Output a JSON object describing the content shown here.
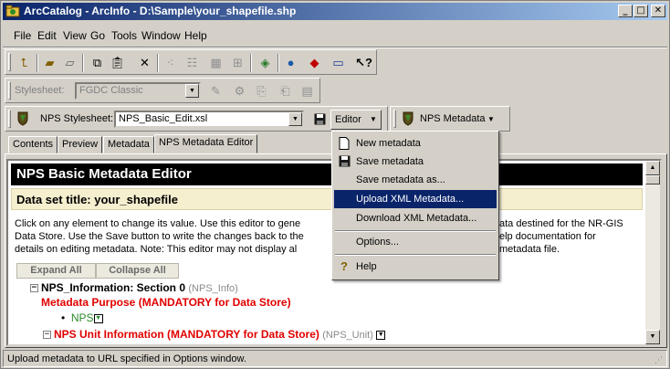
{
  "window": {
    "title": "ArcCatalog - ArcInfo - D:\\Sample\\your_shapefile.shp",
    "minimize": "_",
    "maximize": "□",
    "close": "✕"
  },
  "menu": [
    "File",
    "Edit",
    "View",
    "Go",
    "Tools",
    "Window",
    "Help"
  ],
  "stylesheet_bar": {
    "label": "Stylesheet:",
    "value": "FGDC Classic"
  },
  "nps_bar": {
    "label": "NPS Stylesheet:",
    "value": "NPS_Basic_Edit.xsl",
    "editor_label": "Editor",
    "metadata_label": "NPS Metadata"
  },
  "tabs": [
    "Contents",
    "Preview",
    "Metadata",
    "NPS Metadata Editor"
  ],
  "active_tab": "NPS Metadata Editor",
  "editor": {
    "header": "NPS Basic Metadata Editor",
    "dataset_title": "Data set title: your_shapefile",
    "intro_lines": [
      "Click on any element to change its value. Use this editor to gene",
      "Data Store. Use the Save button to write the changes back to the",
      "details on editing metadata. Note: This editor may not display al"
    ],
    "intro_right_lines": [
      "ata destined for the NR-GIS",
      "elp documentation for",
      "metadata file."
    ],
    "expand_all": "Expand All",
    "collapse_all": "Collapse All",
    "section_title": "NPS_Information: Section 0",
    "section_tag": "(NPS_Info)",
    "metadata_purpose": "Metadata Purpose (MANDATORY for Data Store)",
    "purpose_value": "NPS",
    "unit_info": "NPS Unit Information (MANDATORY for Data Store)",
    "unit_tag": "(NPS_Unit)"
  },
  "editor_menu": {
    "items": [
      {
        "label": "New metadata",
        "icon": "new-document-icon"
      },
      {
        "label": "Save metadata",
        "icon": "save-icon"
      },
      {
        "label": "Save metadata as...",
        "icon": ""
      },
      {
        "label": "Upload XML Metadata...",
        "icon": "",
        "highlighted": true
      },
      {
        "label": "Download XML Metadata...",
        "icon": ""
      },
      {
        "label": "Options...",
        "icon": ""
      },
      {
        "label": "Help",
        "icon": "help-icon"
      }
    ]
  },
  "status": "Upload metadata to URL specified in Options window.",
  "colors": {
    "titlebar_start": "#0a246a",
    "titlebar_end": "#a6caf0",
    "highlight": "#0a246a",
    "mandatory_red": "#e00000",
    "dataset_bg": "#f5efcf"
  }
}
